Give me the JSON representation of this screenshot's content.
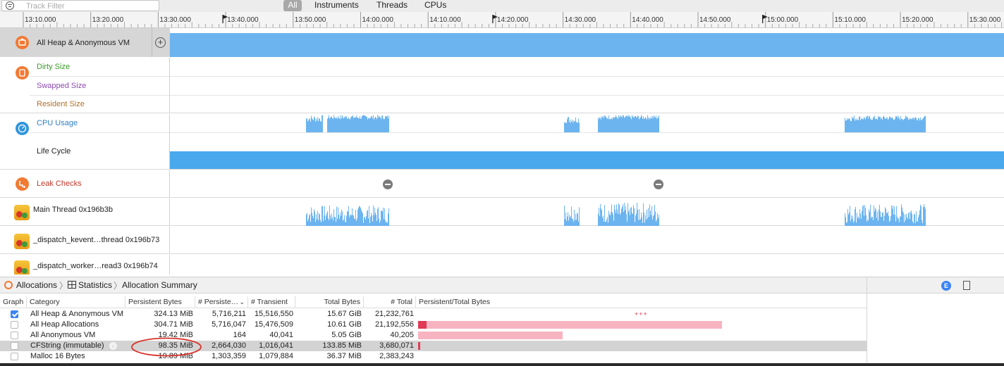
{
  "filter": {
    "placeholder": "Track Filter"
  },
  "scope_tabs": {
    "all": "All",
    "instruments": "Instruments",
    "threads": "Threads",
    "cpus": "CPUs"
  },
  "ruler": {
    "ticks": [
      "13:10.000",
      "13:20.000",
      "13:30.000",
      "13:40.000",
      "13:50.000",
      "14:00.000",
      "14:10.000",
      "14:20.000",
      "14:30.000",
      "14:40.000",
      "14:50.000",
      "15:00.000",
      "15:10.000",
      "15:20.000",
      "15:30.000"
    ],
    "flag_tick_indices": [
      3,
      7,
      11
    ]
  },
  "tracks": {
    "heap": {
      "label": "All Heap & Anonymous VM",
      "add_icon": "plus-circle-icon"
    },
    "vm": {
      "dirty": "Dirty Size",
      "swapped": "Swapped Size",
      "resident": "Resident Size"
    },
    "cpu": {
      "usage": "CPU Usage",
      "lifecycle": "Life Cycle"
    },
    "leaks": {
      "label": "Leak Checks"
    },
    "threads": [
      {
        "name": "Main Thread  0x196b3b"
      },
      {
        "name": "_dispatch_kevent…thread  0x196b73"
      },
      {
        "name": "_dispatch_worker…read3  0x196b74"
      }
    ]
  },
  "detail": {
    "breadcrumb": {
      "root": "Allocations",
      "view": "Statistics",
      "summary": "Allocation Summary"
    },
    "columns": {
      "graph": "Graph",
      "category": "Category",
      "persistent_bytes": "Persistent Bytes",
      "persistent_count": "# Persiste…",
      "transient": "# Transient",
      "total_bytes": "Total Bytes",
      "total": "# Total",
      "ratio": "Persistent/Total Bytes"
    },
    "rows": [
      {
        "checked": true,
        "category": "All Heap & Anonymous VM",
        "persistent_bytes": "324.13 MiB",
        "persistent": "5,716,211",
        "transient": "15,516,550",
        "total_bytes": "15.67 GiB",
        "total": "21,232,761",
        "ratio_text": "+++",
        "ratio_persistent": 0,
        "ratio_total": 0
      },
      {
        "checked": false,
        "category": "All Heap Allocations",
        "persistent_bytes": "304.71 MiB",
        "persistent": "5,716,047",
        "transient": "15,476,509",
        "total_bytes": "10.61 GiB",
        "total": "21,192,556",
        "ratio_text": "",
        "ratio_persistent": 0.028,
        "ratio_total": 1.0
      },
      {
        "checked": false,
        "category": "All Anonymous VM",
        "persistent_bytes": "19.42 MiB",
        "persistent": "164",
        "transient": "40,041",
        "total_bytes": "5.05 GiB",
        "total": "40,205",
        "ratio_text": "",
        "ratio_persistent": 0.0,
        "ratio_total": 0.476
      },
      {
        "checked": false,
        "category": "CFString (immutable)",
        "persistent_bytes": "98.35 MiB",
        "persistent": "2,664,030",
        "transient": "1,016,041",
        "total_bytes": "133.85 MiB",
        "total": "3,680,071",
        "ratio_text": "",
        "ratio_persistent": 0.008,
        "ratio_total": 0.0
      },
      {
        "checked": false,
        "category": "Malloc 16 Bytes",
        "persistent_bytes": "19.89 MiB",
        "persistent": "1,303,359",
        "transient": "1,079,884",
        "total_bytes": "36.37 MiB",
        "total": "2,383,243",
        "ratio_text": "",
        "ratio_persistent": 0,
        "ratio_total": 0
      }
    ]
  },
  "colors": {
    "track_blue": "#6cb4ef",
    "lifecycle_blue": "#4aa8ec",
    "accent_orange": "#f17a34",
    "dirty_green": "#3a9a2a",
    "swapped_purple": "#8a4bb0",
    "resident_brown": "#b0702a",
    "cpu_blue": "#2f7ec0",
    "leak_red": "#c0392b",
    "ratio_red": "#e03a55",
    "ratio_pink": "#f7b4c0",
    "highlight_circle": "#d7332a"
  }
}
